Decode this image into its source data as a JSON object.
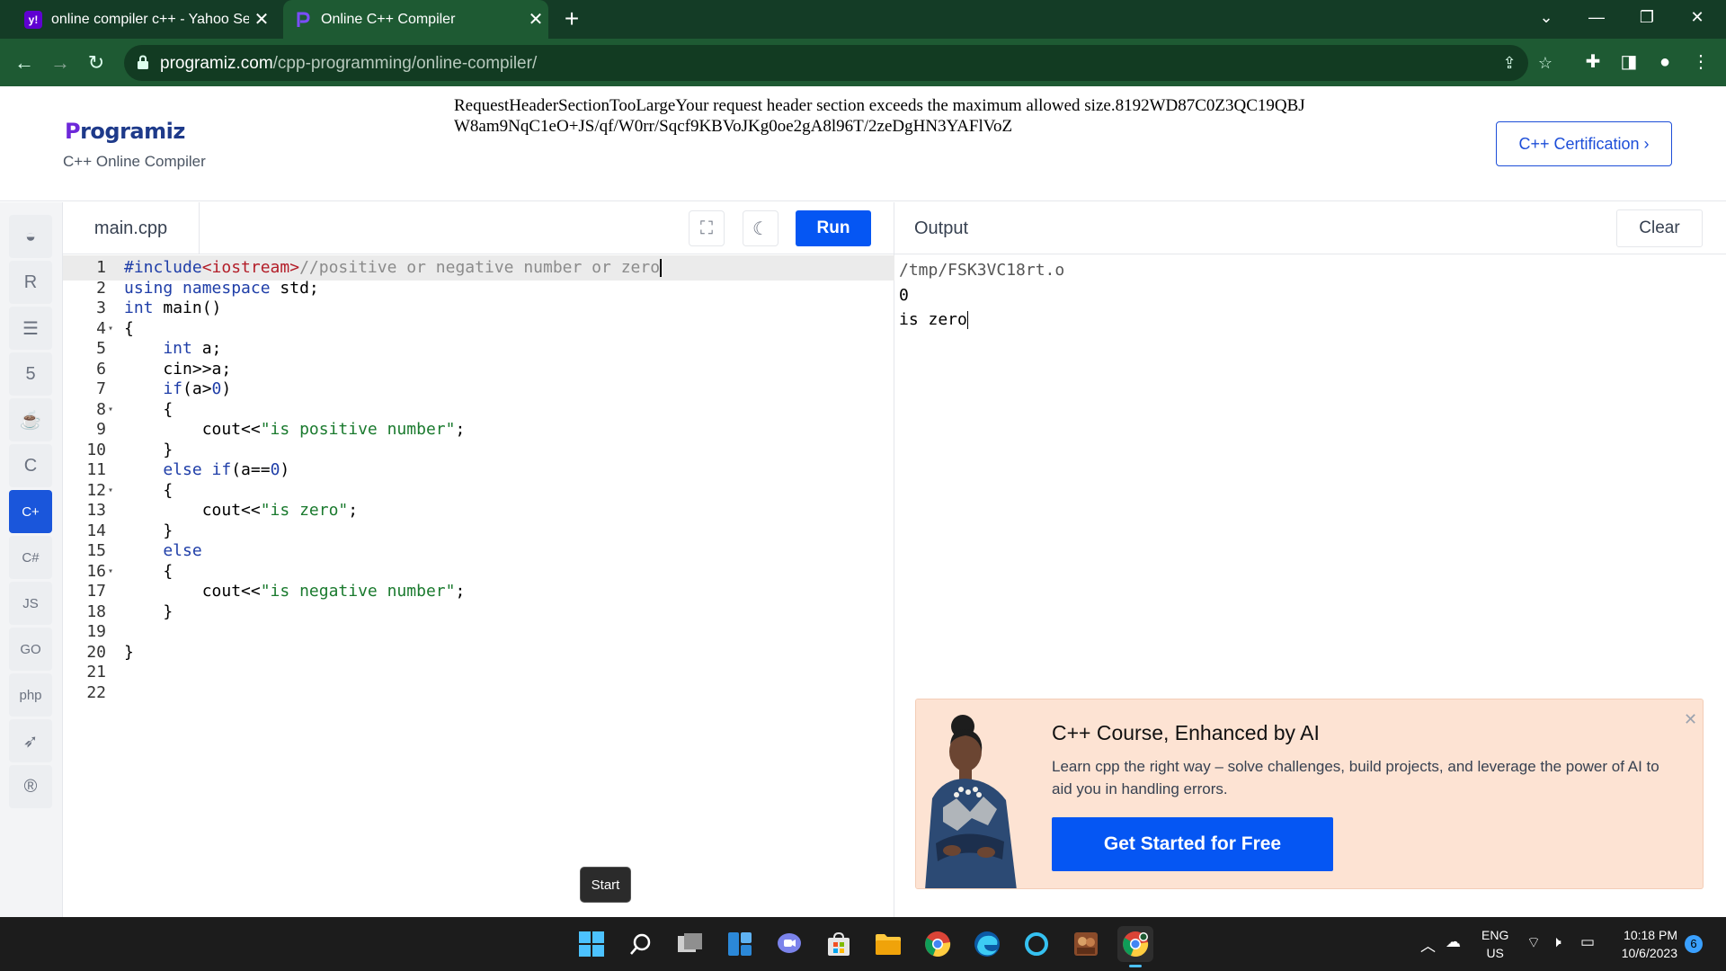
{
  "browser": {
    "tabs": [
      {
        "title": "online compiler c++ - Yahoo Se",
        "favicon": "y!"
      },
      {
        "title": "Online C++ Compiler",
        "favicon": "P"
      }
    ],
    "new_tab": "+",
    "url_domain": "programiz.com",
    "url_path": "/cpp-programming/online-compiler/"
  },
  "header": {
    "logo_prefix": "P",
    "logo_rest": "rogramiz",
    "subtitle": "C++ Online Compiler",
    "error_text": "RequestHeaderSectionTooLargeYour request header section exceeds the maximum allowed size.8192WD87C0Z3QC19QBJW8am9NqC1eO+JS/qf/W0rr/Sqcf9KBVoJKg0oe2gA8l96T/2zeDgHN3YAFlVoZ",
    "certification_button": "C++ Certification ›"
  },
  "rail": {
    "items": [
      {
        "name": "python-icon",
        "glyph": "◒"
      },
      {
        "name": "r-icon",
        "glyph": "R"
      },
      {
        "name": "database-icon",
        "glyph": "☰"
      },
      {
        "name": "html5-icon",
        "glyph": "5"
      },
      {
        "name": "java-icon",
        "glyph": "☕"
      },
      {
        "name": "c-icon",
        "glyph": "C"
      },
      {
        "name": "cpp-icon",
        "glyph": "C+"
      },
      {
        "name": "csharp-icon",
        "glyph": "C#"
      },
      {
        "name": "javascript-icon",
        "glyph": "JS"
      },
      {
        "name": "go-icon",
        "glyph": "GO"
      },
      {
        "name": "php-icon",
        "glyph": "php"
      },
      {
        "name": "swift-icon",
        "glyph": "➶"
      },
      {
        "name": "rust-icon",
        "glyph": "®"
      }
    ],
    "active_index": 6
  },
  "editor": {
    "filename": "main.cpp",
    "run_label": "Run",
    "lines": [
      {
        "n": "1",
        "fold": ""
      },
      {
        "n": "2",
        "fold": ""
      },
      {
        "n": "3",
        "fold": ""
      },
      {
        "n": "4",
        "fold": "▾"
      },
      {
        "n": "5",
        "fold": ""
      },
      {
        "n": "6",
        "fold": ""
      },
      {
        "n": "7",
        "fold": ""
      },
      {
        "n": "8",
        "fold": "▾"
      },
      {
        "n": "9",
        "fold": ""
      },
      {
        "n": "10",
        "fold": ""
      },
      {
        "n": "11",
        "fold": ""
      },
      {
        "n": "12",
        "fold": "▾"
      },
      {
        "n": "13",
        "fold": ""
      },
      {
        "n": "14",
        "fold": ""
      },
      {
        "n": "15",
        "fold": ""
      },
      {
        "n": "16",
        "fold": "▾"
      },
      {
        "n": "17",
        "fold": ""
      },
      {
        "n": "18",
        "fold": ""
      },
      {
        "n": "19",
        "fold": ""
      },
      {
        "n": "20",
        "fold": ""
      },
      {
        "n": "21",
        "fold": ""
      },
      {
        "n": "22",
        "fold": ""
      }
    ],
    "code": {
      "l1a": "#include",
      "l1b": "<iostream>",
      "l1c": "//positive or negative number or zero",
      "l2a": "using",
      "l2b": " namespace",
      "l2c": " std;",
      "l3a": "int",
      "l3b": " main()",
      "l4": "{",
      "l5a": "    int",
      "l5b": " a;",
      "l6": "    cin>>a;",
      "l7a": "    if",
      "l7b": "(a>",
      "l7c": "0",
      "l7d": ")",
      "l8": "    {",
      "l9a": "        cout<<",
      "l9b": "\"is positive number\"",
      "l9c": ";",
      "l10": "    }",
      "l11a": "    else if",
      "l11b": "(a==",
      "l11c": "0",
      "l11d": ")",
      "l12": "    {",
      "l13a": "        cout<<",
      "l13b": "\"is zero\"",
      "l13c": ";",
      "l14": "    }",
      "l15": "    else",
      "l16": "    {",
      "l17a": "        cout<<",
      "l17b": "\"is negative number\"",
      "l17c": ";",
      "l18": "    }",
      "l20": "}"
    }
  },
  "output": {
    "label": "Output",
    "clear_label": "Clear",
    "lines": [
      "/tmp/FSK3VC18rt.o",
      "0",
      "is zero"
    ]
  },
  "ad": {
    "title": "C++ Course, Enhanced by AI",
    "description": "Learn cpp the right way – solve challenges, build projects, and leverage the power of AI to aid you in handling errors.",
    "cta": "Get Started for Free",
    "close": "✕"
  },
  "tooltip": "Start",
  "taskbar": {
    "lang_line1": "ENG",
    "lang_line2": "US",
    "time": "10:18 PM",
    "date": "10/6/2023",
    "notifications": "6"
  },
  "colors": {
    "accent": "#0556f3",
    "tabbar": "#143c26",
    "toolbar": "#1e5a33"
  }
}
